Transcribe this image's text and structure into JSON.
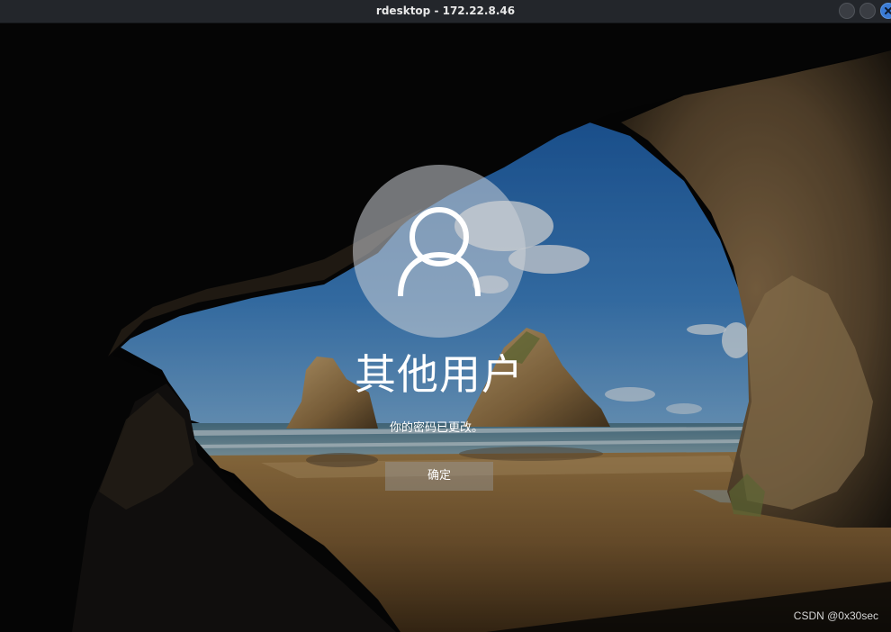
{
  "window": {
    "title": "rdesktop - 172.22.8.46"
  },
  "login": {
    "username": "其他用户",
    "message": "你的密码已更改。",
    "ok_label": "确定",
    "avatar_icon": "user-icon"
  },
  "watermark": {
    "text": "CSDN @0x30sec"
  },
  "colors": {
    "titlebar": "#23262b",
    "close_button": "#3a7bd5",
    "sky": "#2f6db0",
    "sand": "#8a6a3e"
  }
}
